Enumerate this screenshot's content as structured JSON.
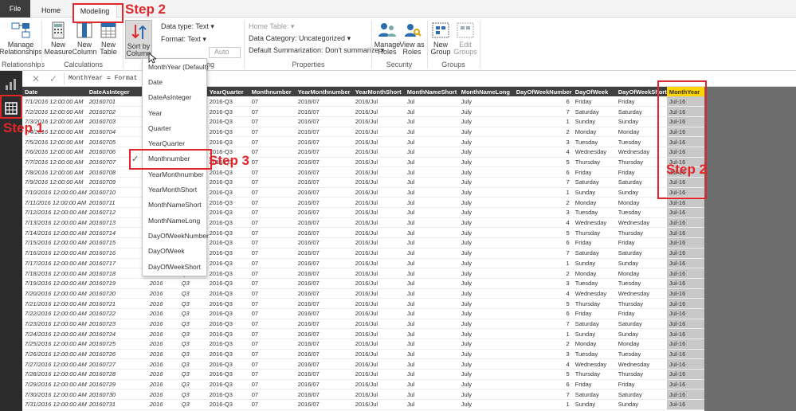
{
  "tabs": {
    "file": "File",
    "home": "Home",
    "modeling": "Modeling"
  },
  "ribbon": {
    "manage_relationships": "Manage\nRelationships",
    "new_measure": "New\nMeasure",
    "new_column": "New\nColumn",
    "new_table": "New\nTable",
    "sort_by_column": "Sort by\nColumn",
    "data_type": "Data type: Text",
    "format": "Format: Text",
    "currency": "$",
    "percent": "%",
    "comma": ",",
    "auto": "Auto",
    "home_table": "Home Table:",
    "data_category": "Data Category: Uncategorized",
    "default_summarization": "Default Summarization: Don't summarize",
    "manage_roles": "Manage\nRoles",
    "view_as_roles": "View as\nRoles",
    "new_group": "New\nGroup",
    "edit_groups": "Edit\nGroups",
    "groups": {
      "relationships": "Relationships",
      "calculations": "Calculations",
      "formatting": "ing",
      "properties": "Properties",
      "security": "Security",
      "groups": "Groups"
    }
  },
  "formula": {
    "text": "MonthYear = Format"
  },
  "columns": [
    "Date",
    "DateAsInteger",
    "Year",
    "Quarter",
    "YearQuarter",
    "Monthnumber",
    "YearMonthnumber",
    "YearMonthShort",
    "MonthNameShort",
    "MonthNameLong",
    "DayOfWeekNumber",
    "DayOfWeek",
    "DayOfWeekShort",
    "MonthYear"
  ],
  "rows": [
    [
      "7/1/2016 12:00:00 AM",
      "20160701",
      "2016",
      "Q3",
      "2016-Q3",
      "07",
      "2016/07",
      "2016/Jul",
      "Jul",
      "July",
      "6",
      "Friday",
      "Friday",
      "Jul-16"
    ],
    [
      "7/2/2016 12:00:00 AM",
      "20160702",
      "2016",
      "Q3",
      "2016-Q3",
      "07",
      "2016/07",
      "2016/Jul",
      "Jul",
      "July",
      "7",
      "Saturday",
      "Saturday",
      "Jul-16"
    ],
    [
      "7/3/2016 12:00:00 AM",
      "20160703",
      "2016",
      "Q3",
      "2016-Q3",
      "07",
      "2016/07",
      "2016/Jul",
      "Jul",
      "July",
      "1",
      "Sunday",
      "Sunday",
      "Jul-16"
    ],
    [
      "7/4/2016 12:00:00 AM",
      "20160704",
      "2016",
      "Q3",
      "2016-Q3",
      "07",
      "2016/07",
      "2016/Jul",
      "Jul",
      "July",
      "2",
      "Monday",
      "Monday",
      "Jul-16"
    ],
    [
      "7/5/2016 12:00:00 AM",
      "20160705",
      "2016",
      "Q3",
      "2016-Q3",
      "07",
      "2016/07",
      "2016/Jul",
      "Jul",
      "July",
      "3",
      "Tuesday",
      "Tuesday",
      "Jul-16"
    ],
    [
      "7/6/2016 12:00:00 AM",
      "20160706",
      "2016",
      "Q3",
      "2016-Q3",
      "07",
      "2016/07",
      "2016/Jul",
      "Jul",
      "July",
      "4",
      "Wednesday",
      "Wednesday",
      "Jul-16"
    ],
    [
      "7/7/2016 12:00:00 AM",
      "20160707",
      "2016",
      "Q3",
      "2016-Q3",
      "07",
      "2016/07",
      "2016/Jul",
      "Jul",
      "July",
      "5",
      "Thursday",
      "Thursday",
      "Jul-16"
    ],
    [
      "7/8/2016 12:00:00 AM",
      "20160708",
      "2016",
      "Q3",
      "2016-Q3",
      "07",
      "2016/07",
      "2016/Jul",
      "Jul",
      "July",
      "6",
      "Friday",
      "Friday",
      "Jul-16"
    ],
    [
      "7/9/2016 12:00:00 AM",
      "20160709",
      "2016",
      "Q3",
      "2016-Q3",
      "07",
      "2016/07",
      "2016/Jul",
      "Jul",
      "July",
      "7",
      "Saturday",
      "Saturday",
      "Jul-16"
    ],
    [
      "7/10/2016 12:00:00 AM",
      "20160710",
      "2016",
      "Q3",
      "2016-Q3",
      "07",
      "2016/07",
      "2016/Jul",
      "Jul",
      "July",
      "1",
      "Sunday",
      "Sunday",
      "Jul-16"
    ],
    [
      "7/11/2016 12:00:00 AM",
      "20160711",
      "2016",
      "Q3",
      "2016-Q3",
      "07",
      "2016/07",
      "2016/Jul",
      "Jul",
      "July",
      "2",
      "Monday",
      "Monday",
      "Jul-16"
    ],
    [
      "7/12/2016 12:00:00 AM",
      "20160712",
      "2016",
      "Q3",
      "2016-Q3",
      "07",
      "2016/07",
      "2016/Jul",
      "Jul",
      "July",
      "3",
      "Tuesday",
      "Tuesday",
      "Jul-16"
    ],
    [
      "7/13/2016 12:00:00 AM",
      "20160713",
      "2016",
      "Q3",
      "2016-Q3",
      "07",
      "2016/07",
      "2016/Jul",
      "Jul",
      "July",
      "4",
      "Wednesday",
      "Wednesday",
      "Jul-16"
    ],
    [
      "7/14/2016 12:00:00 AM",
      "20160714",
      "2016",
      "Q3",
      "2016-Q3",
      "07",
      "2016/07",
      "2016/Jul",
      "Jul",
      "July",
      "5",
      "Thursday",
      "Thursday",
      "Jul-16"
    ],
    [
      "7/15/2016 12:00:00 AM",
      "20160715",
      "2016",
      "Q3",
      "2016-Q3",
      "07",
      "2016/07",
      "2016/Jul",
      "Jul",
      "July",
      "6",
      "Friday",
      "Friday",
      "Jul-16"
    ],
    [
      "7/16/2016 12:00:00 AM",
      "20160716",
      "2016",
      "Q3",
      "2016-Q3",
      "07",
      "2016/07",
      "2016/Jul",
      "Jul",
      "July",
      "7",
      "Saturday",
      "Saturday",
      "Jul-16"
    ],
    [
      "7/17/2016 12:00:00 AM",
      "20160717",
      "2016",
      "Q3",
      "2016-Q3",
      "07",
      "2016/07",
      "2016/Jul",
      "Jul",
      "July",
      "1",
      "Sunday",
      "Sunday",
      "Jul-16"
    ],
    [
      "7/18/2016 12:00:00 AM",
      "20160718",
      "2016",
      "Q3",
      "2016-Q3",
      "07",
      "2016/07",
      "2016/Jul",
      "Jul",
      "July",
      "2",
      "Monday",
      "Monday",
      "Jul-16"
    ],
    [
      "7/19/2016 12:00:00 AM",
      "20160719",
      "2016",
      "Q3",
      "2016-Q3",
      "07",
      "2016/07",
      "2016/Jul",
      "Jul",
      "July",
      "3",
      "Tuesday",
      "Tuesday",
      "Jul-16"
    ],
    [
      "7/20/2016 12:00:00 AM",
      "20160720",
      "2016",
      "Q3",
      "2016-Q3",
      "07",
      "2016/07",
      "2016/Jul",
      "Jul",
      "July",
      "4",
      "Wednesday",
      "Wednesday",
      "Jul-16"
    ],
    [
      "7/21/2016 12:00:00 AM",
      "20160721",
      "2016",
      "Q3",
      "2016-Q3",
      "07",
      "2016/07",
      "2016/Jul",
      "Jul",
      "July",
      "5",
      "Thursday",
      "Thursday",
      "Jul-16"
    ],
    [
      "7/22/2016 12:00:00 AM",
      "20160722",
      "2016",
      "Q3",
      "2016-Q3",
      "07",
      "2016/07",
      "2016/Jul",
      "Jul",
      "July",
      "6",
      "Friday",
      "Friday",
      "Jul-16"
    ],
    [
      "7/23/2016 12:00:00 AM",
      "20160723",
      "2016",
      "Q3",
      "2016-Q3",
      "07",
      "2016/07",
      "2016/Jul",
      "Jul",
      "July",
      "7",
      "Saturday",
      "Saturday",
      "Jul-16"
    ],
    [
      "7/24/2016 12:00:00 AM",
      "20160724",
      "2016",
      "Q3",
      "2016-Q3",
      "07",
      "2016/07",
      "2016/Jul",
      "Jul",
      "July",
      "1",
      "Sunday",
      "Sunday",
      "Jul-16"
    ],
    [
      "7/25/2016 12:00:00 AM",
      "20160725",
      "2016",
      "Q3",
      "2016-Q3",
      "07",
      "2016/07",
      "2016/Jul",
      "Jul",
      "July",
      "2",
      "Monday",
      "Monday",
      "Jul-16"
    ],
    [
      "7/26/2016 12:00:00 AM",
      "20160726",
      "2016",
      "Q3",
      "2016-Q3",
      "07",
      "2016/07",
      "2016/Jul",
      "Jul",
      "July",
      "3",
      "Tuesday",
      "Tuesday",
      "Jul-16"
    ],
    [
      "7/27/2016 12:00:00 AM",
      "20160727",
      "2016",
      "Q3",
      "2016-Q3",
      "07",
      "2016/07",
      "2016/Jul",
      "Jul",
      "July",
      "4",
      "Wednesday",
      "Wednesday",
      "Jul-16"
    ],
    [
      "7/28/2016 12:00:00 AM",
      "20160728",
      "2016",
      "Q3",
      "2016-Q3",
      "07",
      "2016/07",
      "2016/Jul",
      "Jul",
      "July",
      "5",
      "Thursday",
      "Thursday",
      "Jul-16"
    ],
    [
      "7/29/2016 12:00:00 AM",
      "20160729",
      "2016",
      "Q3",
      "2016-Q3",
      "07",
      "2016/07",
      "2016/Jul",
      "Jul",
      "July",
      "6",
      "Friday",
      "Friday",
      "Jul-16"
    ],
    [
      "7/30/2016 12:00:00 AM",
      "20160730",
      "2016",
      "Q3",
      "2016-Q3",
      "07",
      "2016/07",
      "2016/Jul",
      "Jul",
      "July",
      "7",
      "Saturday",
      "Saturday",
      "Jul-16"
    ],
    [
      "7/31/2016 12:00:00 AM",
      "20160731",
      "2016",
      "Q3",
      "2016-Q3",
      "07",
      "2016/07",
      "2016/Jul",
      "Jul",
      "July",
      "1",
      "Sunday",
      "Sunday",
      "Jul-16"
    ]
  ],
  "sort_menu": {
    "items": [
      "MonthYear (Default)",
      "Date",
      "DateAsInteger",
      "Year",
      "Quarter",
      "YearQuarter",
      "Monthnumber",
      "YearMonthnumber",
      "YearMonthShort",
      "MonthNameShort",
      "MonthNameLong",
      "DayOfWeekNumber",
      "DayOfWeek",
      "DayOfWeekShort"
    ],
    "selected": "Monthnumber"
  },
  "annotations": {
    "step1": "Step 1",
    "step2_top": "Step 2",
    "step2_right": "Step 2",
    "step3": "Step 3"
  },
  "colors": {
    "accent_red": "#e0262b",
    "header_dark": "#3f3f3f",
    "highlight_yellow": "#ffd400"
  }
}
